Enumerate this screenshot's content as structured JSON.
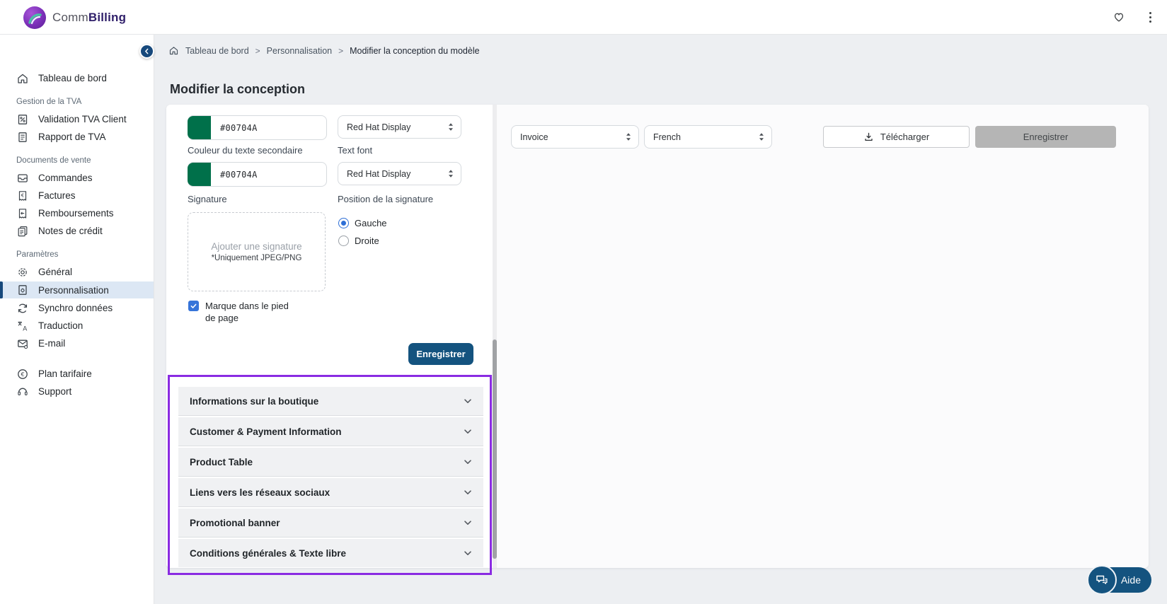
{
  "header": {
    "brand_prefix": "Comm",
    "brand_suffix": "Billing"
  },
  "sidebar": {
    "sections": [
      {
        "items": [
          {
            "label": "Tableau de bord"
          }
        ]
      },
      {
        "header": "Gestion de la TVA",
        "items": [
          {
            "label": "Validation TVA Client"
          },
          {
            "label": "Rapport de TVA"
          }
        ]
      },
      {
        "header": "Documents de vente",
        "items": [
          {
            "label": "Commandes"
          },
          {
            "label": "Factures"
          },
          {
            "label": "Remboursements"
          },
          {
            "label": "Notes de crédit"
          }
        ]
      },
      {
        "header": "Paramètres",
        "items": [
          {
            "label": "Général"
          },
          {
            "label": "Personnalisation",
            "active": true
          },
          {
            "label": "Synchro données"
          },
          {
            "label": "Traduction"
          },
          {
            "label": "E-mail"
          }
        ]
      },
      {
        "items": [
          {
            "label": "Plan tarifaire"
          },
          {
            "label": "Support"
          }
        ]
      }
    ]
  },
  "breadcrumb": {
    "items": [
      "Tableau de bord",
      "Personnalisation",
      "Modifier la conception du modèle"
    ]
  },
  "page": {
    "title": "Modifier la conception"
  },
  "form": {
    "primary_color_value": "#00704A",
    "primary_font": "Red Hat Display",
    "secondary_color_label": "Couleur du texte secondaire",
    "secondary_color_value": "#00704A",
    "text_font_label": "Text font",
    "secondary_font": "Red Hat Display",
    "signature_label": "Signature",
    "signature_placeholder": "Ajouter une signature",
    "signature_note": "*Uniquement JPEG/PNG",
    "signature_position_label": "Position de la signature",
    "position_options": [
      {
        "label": "Gauche",
        "selected": true
      },
      {
        "label": "Droite",
        "selected": false
      }
    ],
    "footer_brand_label": "Marque dans le pied de page",
    "footer_brand_checked": true,
    "save_label": "Enregistrer"
  },
  "accordions": {
    "items": [
      "Informations sur la boutique",
      "Customer & Payment Information",
      "Product Table",
      "Liens vers les réseaux sociaux",
      "Promotional banner",
      "Conditions générales & Texte libre"
    ]
  },
  "preview": {
    "document_type": "Invoice",
    "language": "French",
    "download_label": "Télécharger",
    "save_label": "Enregistrer",
    "save_disabled": true
  },
  "help": {
    "label": "Aide"
  },
  "icons": [
    "commbilling-logo-icon",
    "favorite-heart-icon",
    "kebab-menu-icon",
    "sidebar-collapse-icon",
    "home-icon",
    "vat-validation-icon",
    "vat-report-icon",
    "orders-icon",
    "invoices-icon",
    "refunds-icon",
    "credit-notes-icon",
    "gear-icon",
    "personalization-icon",
    "sync-icon",
    "translate-icon",
    "email-icon",
    "pricing-icon",
    "support-icon",
    "breadcrumb-home-icon",
    "select-stepper-icon",
    "checkbox-check-icon",
    "chevron-down-icon",
    "download-icon",
    "chat-icon"
  ],
  "colors": {
    "accent_blue": "#14537F",
    "annotation_purple": "#8A2BE2",
    "swatch_green": "#00704A",
    "active_item_bg": "#DCE7F4",
    "disabled_button_bg": "#B5B5B5",
    "radio_checkbox_blue": "#3674D9"
  }
}
